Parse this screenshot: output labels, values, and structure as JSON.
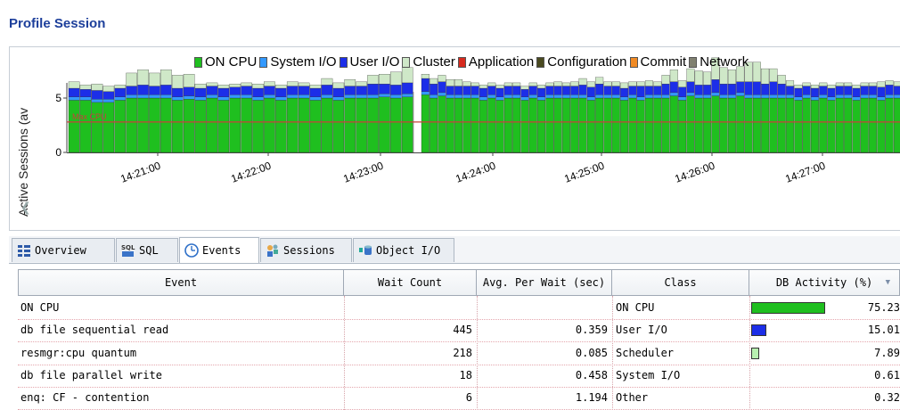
{
  "title": "Profile Session",
  "chart": {
    "ylabel": "Active Sessions (av",
    "yticks": [
      "0",
      "5"
    ],
    "xticks": [
      "14:21:00",
      "14:22:00",
      "14:23:00",
      "14:24:00",
      "14:25:00",
      "14:26:00",
      "14:27:00"
    ],
    "cpu_line_label": "Max CPU",
    "legend": [
      {
        "label": "ON CPU",
        "color": "#1fbf1f"
      },
      {
        "label": "System I/O",
        "color": "#3399ff"
      },
      {
        "label": "User I/O",
        "color": "#1c2ee8"
      },
      {
        "label": "Cluster",
        "color": "#cfe8c8"
      },
      {
        "label": "Application",
        "color": "#d62a1e"
      },
      {
        "label": "Configuration",
        "color": "#4a4a20"
      },
      {
        "label": "Commit",
        "color": "#f08a24"
      },
      {
        "label": "Network",
        "color": "#808070"
      }
    ]
  },
  "chart_data": {
    "type": "bar",
    "stacked": true,
    "ylim": [
      0,
      10
    ],
    "cpu_line": 2.8,
    "series_order": [
      "ON CPU",
      "System I/O",
      "User I/O",
      "Cluster"
    ],
    "left_block": [
      [
        4.8,
        0.3,
        0.8,
        0.6
      ],
      [
        4.8,
        0.3,
        0.7,
        0.4
      ],
      [
        4.6,
        0.3,
        0.8,
        0.6
      ],
      [
        4.6,
        0.3,
        0.7,
        0.5
      ],
      [
        4.8,
        0.3,
        0.8,
        0.3
      ],
      [
        5.0,
        0.3,
        0.8,
        1.2
      ],
      [
        5.0,
        0.3,
        0.9,
        1.4
      ],
      [
        5.0,
        0.3,
        0.8,
        1.2
      ],
      [
        5.0,
        0.3,
        0.9,
        1.4
      ],
      [
        4.8,
        0.3,
        0.8,
        1.2
      ],
      [
        4.9,
        0.3,
        0.8,
        1.2
      ],
      [
        4.8,
        0.3,
        0.8,
        0.4
      ],
      [
        5.0,
        0.3,
        0.8,
        0.3
      ],
      [
        4.8,
        0.3,
        0.8,
        0.3
      ],
      [
        5.0,
        0.3,
        0.7,
        0.3
      ],
      [
        5.0,
        0.3,
        0.8,
        0.3
      ],
      [
        4.8,
        0.3,
        0.8,
        0.4
      ],
      [
        5.0,
        0.3,
        0.8,
        0.4
      ],
      [
        4.8,
        0.3,
        0.8,
        0.3
      ],
      [
        5.0,
        0.3,
        0.8,
        0.4
      ],
      [
        5.0,
        0.3,
        0.8,
        0.3
      ],
      [
        4.8,
        0.3,
        0.8,
        0.3
      ],
      [
        5.0,
        0.3,
        0.9,
        0.6
      ],
      [
        4.8,
        0.3,
        0.8,
        0.5
      ],
      [
        5.0,
        0.3,
        0.8,
        0.6
      ],
      [
        5.0,
        0.3,
        0.8,
        0.4
      ],
      [
        5.0,
        0.3,
        1.0,
        0.8
      ],
      [
        5.1,
        0.3,
        0.9,
        0.9
      ],
      [
        5.0,
        0.3,
        0.9,
        1.2
      ],
      [
        5.1,
        0.3,
        1.0,
        1.4
      ]
    ],
    "right_block": [
      [
        5.3,
        0.3,
        1.2,
        0.4
      ],
      [
        5.0,
        0.3,
        1.0,
        0.5
      ],
      [
        5.2,
        0.3,
        1.0,
        0.6
      ],
      [
        5.0,
        0.3,
        0.8,
        0.6
      ],
      [
        5.0,
        0.3,
        0.8,
        0.6
      ],
      [
        5.0,
        0.3,
        0.8,
        0.4
      ],
      [
        5.0,
        0.3,
        0.8,
        0.3
      ],
      [
        4.8,
        0.3,
        0.8,
        0.3
      ],
      [
        5.0,
        0.3,
        0.8,
        0.3
      ],
      [
        4.8,
        0.3,
        0.8,
        0.3
      ],
      [
        5.0,
        0.3,
        0.8,
        0.3
      ],
      [
        5.0,
        0.3,
        0.8,
        0.3
      ],
      [
        4.8,
        0.3,
        0.7,
        0.3
      ],
      [
        5.0,
        0.3,
        0.8,
        0.3
      ],
      [
        4.8,
        0.3,
        0.8,
        0.3
      ],
      [
        5.0,
        0.3,
        0.8,
        0.3
      ],
      [
        5.0,
        0.3,
        0.8,
        0.4
      ],
      [
        5.0,
        0.3,
        0.8,
        0.3
      ],
      [
        5.0,
        0.3,
        0.8,
        0.4
      ],
      [
        5.0,
        0.3,
        0.9,
        0.6
      ],
      [
        4.8,
        0.3,
        0.9,
        0.5
      ],
      [
        5.0,
        0.3,
        1.0,
        0.6
      ],
      [
        5.0,
        0.3,
        0.8,
        0.4
      ],
      [
        5.0,
        0.3,
        0.8,
        0.4
      ],
      [
        4.8,
        0.3,
        0.8,
        0.5
      ],
      [
        5.0,
        0.3,
        0.8,
        0.4
      ],
      [
        4.8,
        0.3,
        1.0,
        0.4
      ],
      [
        5.0,
        0.3,
        0.8,
        0.5
      ],
      [
        5.0,
        0.3,
        0.8,
        0.4
      ],
      [
        5.0,
        0.3,
        1.0,
        0.8
      ],
      [
        5.2,
        0.3,
        1.0,
        1.1
      ],
      [
        4.8,
        0.3,
        0.9,
        0.6
      ],
      [
        5.2,
        0.3,
        1.0,
        1.2
      ],
      [
        5.0,
        0.3,
        0.9,
        1.3
      ],
      [
        5.0,
        0.3,
        0.9,
        1.2
      ],
      [
        5.2,
        0.3,
        1.2,
        2.0
      ],
      [
        5.0,
        0.3,
        1.0,
        1.5
      ],
      [
        5.0,
        0.3,
        1.0,
        1.3
      ],
      [
        5.2,
        0.3,
        1.0,
        1.4
      ],
      [
        5.0,
        0.3,
        1.2,
        1.8
      ],
      [
        5.0,
        0.3,
        1.2,
        1.8
      ],
      [
        5.0,
        0.3,
        1.0,
        1.4
      ],
      [
        5.0,
        0.3,
        1.2,
        1.2
      ],
      [
        5.0,
        0.3,
        1.0,
        0.8
      ],
      [
        5.0,
        0.3,
        0.8,
        0.5
      ],
      [
        4.8,
        0.3,
        0.8,
        0.3
      ],
      [
        5.0,
        0.3,
        0.8,
        0.3
      ],
      [
        4.8,
        0.3,
        0.8,
        0.3
      ],
      [
        5.0,
        0.3,
        0.8,
        0.3
      ],
      [
        4.8,
        0.3,
        0.8,
        0.3
      ],
      [
        5.0,
        0.3,
        0.8,
        0.3
      ],
      [
        5.0,
        0.3,
        0.8,
        0.3
      ],
      [
        4.8,
        0.3,
        0.8,
        0.3
      ],
      [
        5.0,
        0.3,
        0.8,
        0.3
      ],
      [
        5.0,
        0.3,
        0.8,
        0.3
      ],
      [
        4.8,
        0.3,
        0.9,
        0.5
      ],
      [
        5.0,
        0.3,
        0.9,
        0.4
      ],
      [
        5.0,
        0.3,
        0.8,
        0.4
      ],
      [
        4.8,
        0.3,
        0.8,
        0.5
      ],
      [
        5.0,
        0.3,
        1.0,
        0.6
      ],
      [
        4.8,
        0.3,
        0.8,
        0.5
      ],
      [
        5.0,
        0.3,
        0.8,
        0.3
      ],
      [
        5.0,
        0.3,
        0.8,
        0.3
      ]
    ]
  },
  "tabs": [
    {
      "label": "Overview",
      "icon": "grid-icon"
    },
    {
      "label": "SQL",
      "icon": "sql-icon"
    },
    {
      "label": "Events",
      "icon": "clock-icon",
      "active": true
    },
    {
      "label": "Sessions",
      "icon": "users-icon"
    },
    {
      "label": "Object I/O",
      "icon": "database-icon"
    }
  ],
  "table": {
    "headers": [
      "Event",
      "Wait Count",
      "Avg. Per Wait (sec)",
      "Class",
      "DB Activity (%)"
    ],
    "sort_indicator": "▼",
    "rows": [
      {
        "event": "ON CPU",
        "wait_count": "",
        "avg_wait": "",
        "class": "ON CPU",
        "activity": "75.23",
        "bar_color": "#1fbf1f",
        "bar_fraction": 0.7523
      },
      {
        "event": "db file sequential read",
        "wait_count": "445",
        "avg_wait": "0.359",
        "class": "User I/O",
        "activity": "15.01",
        "bar_color": "#1c2ee8",
        "bar_fraction": 0.1501
      },
      {
        "event": "resmgr:cpu quantum",
        "wait_count": "218",
        "avg_wait": "0.085",
        "class": "Scheduler",
        "activity": "7.89",
        "bar_color": "#b8f0b0",
        "bar_fraction": 0.0789
      },
      {
        "event": "db file parallel write",
        "wait_count": "18",
        "avg_wait": "0.458",
        "class": "System I/O",
        "activity": "0.61",
        "bar_color": "#3399ff",
        "bar_fraction": 0.0061
      },
      {
        "event": "enq: CF - contention",
        "wait_count": "6",
        "avg_wait": "1.194",
        "class": "Other",
        "activity": "0.32",
        "bar_color": "#888888",
        "bar_fraction": 0.0032
      }
    ]
  }
}
